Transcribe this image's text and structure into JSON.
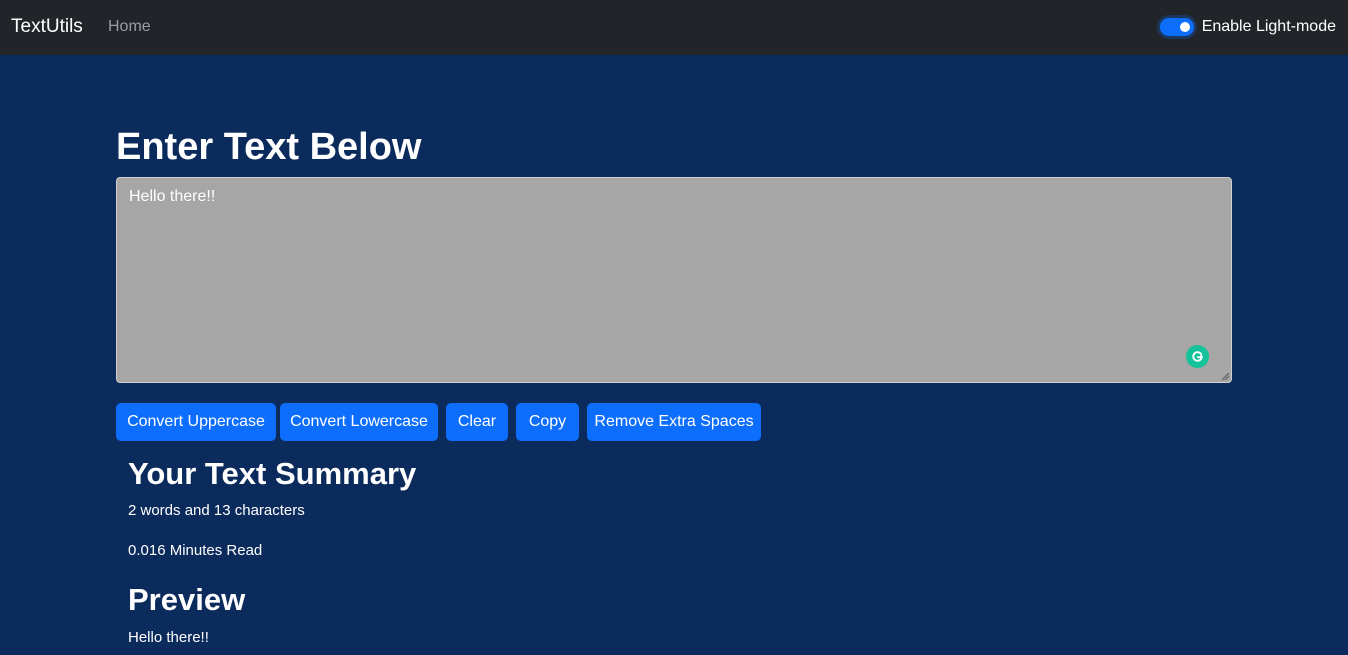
{
  "navbar": {
    "brand": "TextUtils",
    "home_link": "Home",
    "mode_toggle_label": "Enable Light-mode",
    "mode_toggle_checked": true
  },
  "main": {
    "heading": "Enter Text Below",
    "textarea_value": "Hello there!!",
    "buttons": [
      {
        "label": "Convert Uppercase"
      },
      {
        "label": "Convert Lowercase"
      },
      {
        "label": "Clear"
      },
      {
        "label": "Copy"
      },
      {
        "label": "Remove Extra Spaces"
      }
    ]
  },
  "summary": {
    "title": "Your Text Summary",
    "counts": "2 words and 13 characters",
    "read_time": "0.016 Minutes Read"
  },
  "preview": {
    "title": "Preview",
    "text": "Hello there!!"
  },
  "icons": {
    "grammarly": "grammarly-icon",
    "resize": "resize-grip-icon"
  },
  "colors": {
    "background": "#0c2b5d",
    "navbar": "#212529",
    "primary": "#0d6efd",
    "textarea_bg": "#a6a6a6",
    "grammarly": "#15c39a"
  }
}
